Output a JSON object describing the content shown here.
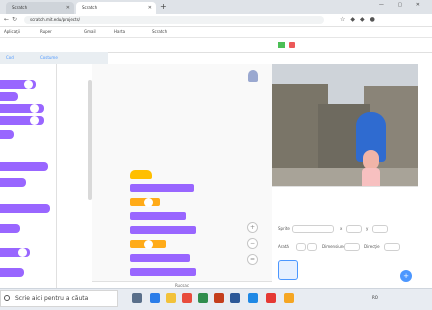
{
  "browser": {
    "tabs": [
      {
        "label": "Scratch"
      },
      {
        "label": "Scratch"
      }
    ],
    "new_tab": "+",
    "window_controls": "— ▢ ✕",
    "address": "scratch.mit.edu/projects/",
    "bookmarks": [
      "Aplicaţii",
      "Ruper",
      "Gmail",
      "Harta",
      "Scratch"
    ]
  },
  "scratch": {
    "code_tabs": [
      "Cod",
      "Costume",
      "Sunete"
    ],
    "backpack_label": "Rucsac",
    "sprite_info": {
      "sprite_label": "Sprite",
      "x_label": "x",
      "y_label": "y",
      "show_label": "Arată",
      "size_label": "Dimensiune",
      "direction_label": "Direcţie"
    },
    "add_sprite_symbol": "+"
  },
  "taskbar": {
    "search_placeholder": "Scrie aici pentru a căuta",
    "tray_text": "RO"
  },
  "colors": {
    "looks_block": "#9966ff",
    "events_block": "#ffbf00",
    "control_block": "#ffab19",
    "motion_block": "#4c97ff",
    "sensing_block": "#5cb1d6",
    "accent": "#4c97ff"
  },
  "icons": {
    "flag": "green-flag-icon",
    "stop": "stop-icon",
    "zoom_in": "zoom-in-icon",
    "zoom_out": "zoom-out-icon",
    "zoom_reset": "zoom-reset-icon",
    "add_sprite": "add-sprite-icon",
    "search": "search-icon"
  }
}
